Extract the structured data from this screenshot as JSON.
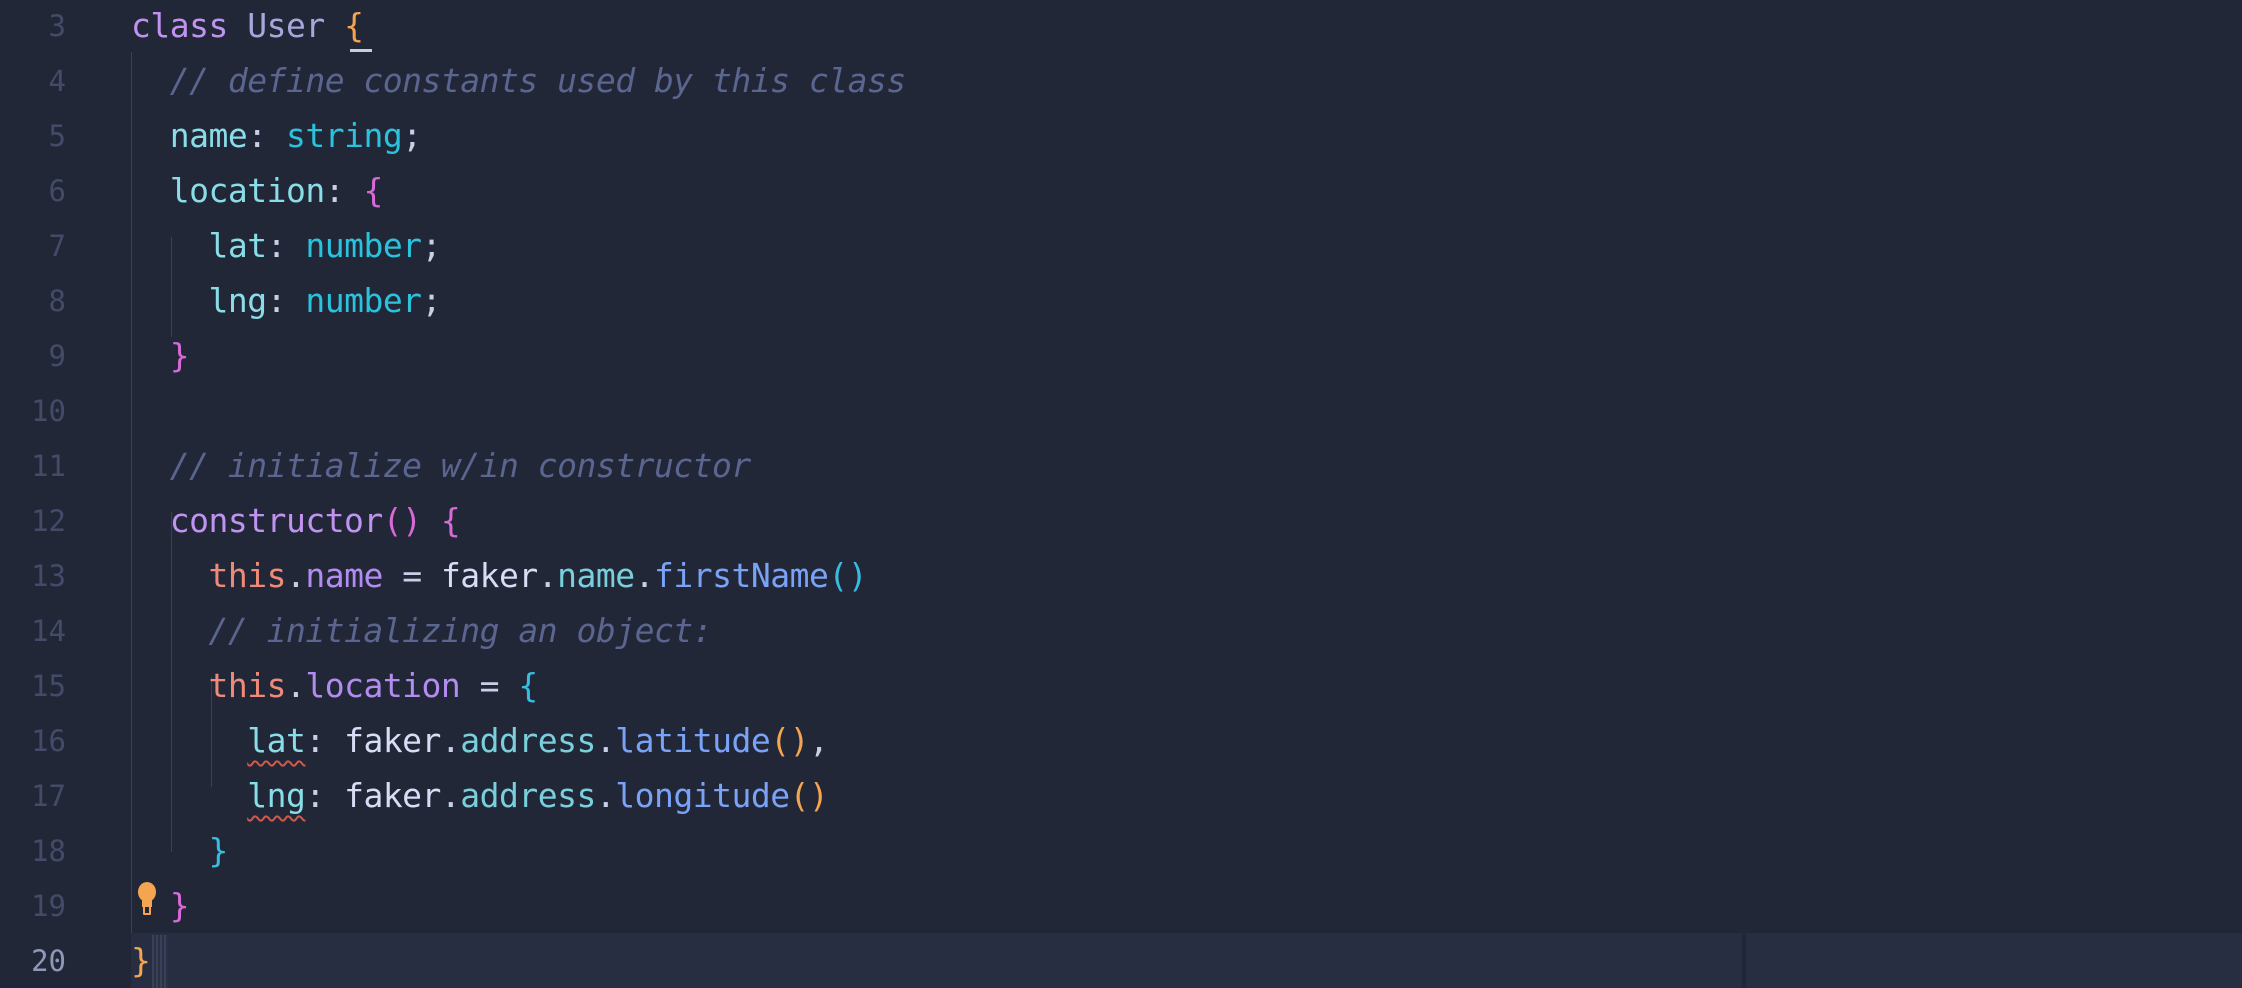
{
  "editor": {
    "active_line": 20,
    "lines": [
      {
        "n": "3",
        "tokens": [
          [
            "kw",
            "class"
          ],
          [
            "punc",
            " "
          ],
          [
            "cls",
            "User"
          ],
          [
            "punc",
            " "
          ],
          [
            "b1",
            "{"
          ]
        ]
      },
      {
        "n": "4",
        "tokens": [
          [
            "punc",
            "  "
          ],
          [
            "cm",
            "// define constants used by this class"
          ]
        ]
      },
      {
        "n": "5",
        "tokens": [
          [
            "punc",
            "  "
          ],
          [
            "prop",
            "name"
          ],
          [
            "punc",
            ": "
          ],
          [
            "type",
            "string"
          ],
          [
            "punc",
            ";"
          ]
        ]
      },
      {
        "n": "6",
        "tokens": [
          [
            "punc",
            "  "
          ],
          [
            "prop",
            "location"
          ],
          [
            "punc",
            ": "
          ],
          [
            "b2",
            "{"
          ]
        ]
      },
      {
        "n": "7",
        "tokens": [
          [
            "punc",
            "    "
          ],
          [
            "prop",
            "lat"
          ],
          [
            "punc",
            ": "
          ],
          [
            "type",
            "number"
          ],
          [
            "punc",
            ";"
          ]
        ]
      },
      {
        "n": "8",
        "tokens": [
          [
            "punc",
            "    "
          ],
          [
            "prop",
            "lng"
          ],
          [
            "punc",
            ": "
          ],
          [
            "type",
            "number"
          ],
          [
            "punc",
            ";"
          ]
        ]
      },
      {
        "n": "9",
        "tokens": [
          [
            "punc",
            "  "
          ],
          [
            "b2",
            "}"
          ]
        ]
      },
      {
        "n": "10",
        "tokens": []
      },
      {
        "n": "11",
        "tokens": [
          [
            "punc",
            "  "
          ],
          [
            "cm",
            "// initialize w/in constructor"
          ]
        ]
      },
      {
        "n": "12",
        "tokens": [
          [
            "punc",
            "  "
          ],
          [
            "kw",
            "constructor"
          ],
          [
            "b2",
            "()"
          ],
          [
            "punc",
            " "
          ],
          [
            "b2",
            "{"
          ]
        ]
      },
      {
        "n": "13",
        "tokens": [
          [
            "punc",
            "    "
          ],
          [
            "this",
            "this"
          ],
          [
            "punc",
            "."
          ],
          [
            "mem",
            "name"
          ],
          [
            "punc",
            " = "
          ],
          [
            "id",
            "faker"
          ],
          [
            "punc",
            "."
          ],
          [
            "obj",
            "name"
          ],
          [
            "punc",
            "."
          ],
          [
            "meth",
            "firstName"
          ],
          [
            "b3",
            "()"
          ]
        ]
      },
      {
        "n": "14",
        "tokens": [
          [
            "punc",
            "    "
          ],
          [
            "cm",
            "// initializing an object:"
          ]
        ]
      },
      {
        "n": "15",
        "tokens": [
          [
            "punc",
            "    "
          ],
          [
            "this",
            "this"
          ],
          [
            "punc",
            "."
          ],
          [
            "mem",
            "location"
          ],
          [
            "punc",
            " = "
          ],
          [
            "b3",
            "{"
          ]
        ]
      },
      {
        "n": "16",
        "tokens": [
          [
            "punc",
            "      "
          ],
          [
            "prop squig",
            "lat"
          ],
          [
            "punc",
            ": "
          ],
          [
            "id",
            "faker"
          ],
          [
            "punc",
            "."
          ],
          [
            "obj",
            "address"
          ],
          [
            "punc",
            "."
          ],
          [
            "meth",
            "latitude"
          ],
          [
            "b1",
            "()"
          ],
          [
            "punc",
            ","
          ]
        ]
      },
      {
        "n": "17",
        "tokens": [
          [
            "punc",
            "      "
          ],
          [
            "prop squig",
            "lng"
          ],
          [
            "punc",
            ": "
          ],
          [
            "id",
            "faker"
          ],
          [
            "punc",
            "."
          ],
          [
            "obj",
            "address"
          ],
          [
            "punc",
            "."
          ],
          [
            "meth",
            "longitude"
          ],
          [
            "b1",
            "()"
          ]
        ]
      },
      {
        "n": "18",
        "tokens": [
          [
            "punc",
            "    "
          ],
          [
            "b3",
            "}"
          ]
        ]
      },
      {
        "n": "19",
        "tokens": [
          [
            "punc",
            "  "
          ],
          [
            "b2",
            "}"
          ]
        ]
      },
      {
        "n": "20",
        "tokens": [
          [
            "b1",
            "}"
          ]
        ]
      }
    ]
  },
  "icons": {
    "lightbulb": "lightbulb-icon"
  },
  "colors": {
    "background": "#222738",
    "lightbulb": "#f5a450"
  }
}
